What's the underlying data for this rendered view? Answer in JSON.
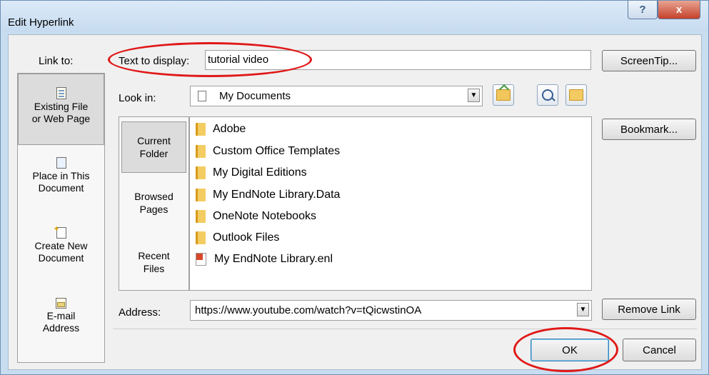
{
  "window": {
    "title": "Edit Hyperlink",
    "help_label": "?",
    "close_label": "x"
  },
  "link_to": {
    "label": "Link to:",
    "items": [
      {
        "line1": "Existing File",
        "line2": "or Web Page"
      },
      {
        "line1": "Place in This",
        "line2": "Document"
      },
      {
        "line1": "Create New",
        "line2": "Document"
      },
      {
        "line1": "E-mail",
        "line2": "Address"
      }
    ]
  },
  "text_display": {
    "label": "Text to display:",
    "value": "tutorial video"
  },
  "look_in": {
    "label": "Look in:",
    "value": "My Documents"
  },
  "nav": {
    "items": [
      {
        "line1": "Current",
        "line2": "Folder"
      },
      {
        "line1": "Browsed",
        "line2": "Pages"
      },
      {
        "line1": "Recent",
        "line2": "Files"
      }
    ]
  },
  "files": [
    {
      "name": "Adobe",
      "icon": "folder-icon"
    },
    {
      "name": "Custom Office Templates",
      "icon": "folder-icon"
    },
    {
      "name": "My Digital Editions",
      "icon": "folder-icon"
    },
    {
      "name": "My EndNote Library.Data",
      "icon": "folder-icon"
    },
    {
      "name": "OneNote Notebooks",
      "icon": "folder-icon"
    },
    {
      "name": "Outlook Files",
      "icon": "folder-icon"
    },
    {
      "name": "My EndNote Library.enl",
      "icon": "endnote-file-icon"
    }
  ],
  "address": {
    "label": "Address:",
    "value": "https://www.youtube.com/watch?v=tQicwstinOA"
  },
  "buttons": {
    "screentip": "ScreenTip...",
    "bookmark": "Bookmark...",
    "remove_link": "Remove Link",
    "ok": "OK",
    "cancel": "Cancel"
  },
  "colors": {
    "annotation": "#e01818",
    "title_bar": "#c9ddf1",
    "close_button": "#c5412a"
  }
}
